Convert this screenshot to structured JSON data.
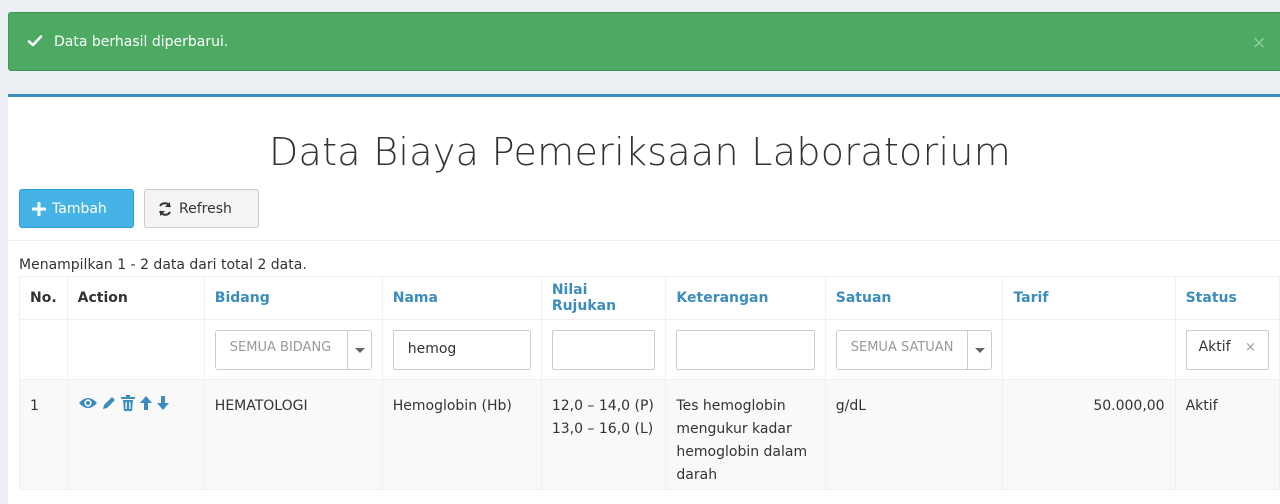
{
  "alert": {
    "message": "Data berhasil diperbarui.",
    "close": "×"
  },
  "page": {
    "title": "Data Biaya Pemeriksaan Laboratorium"
  },
  "toolbar": {
    "add_label": "Tambah",
    "refresh_label": "Refresh"
  },
  "summary": "Menampilkan 1 - 2 data dari total 2 data.",
  "columns": [
    "No.",
    "Action",
    "Bidang",
    "Nama",
    "Nilai Rujukan",
    "Keterangan",
    "Satuan",
    "Tarif",
    "Status"
  ],
  "filters": {
    "bidang": "SEMUA BIDANG",
    "nama": "hemog",
    "nilai_rujukan": "",
    "keterangan": "",
    "satuan": "SEMUA SATUAN",
    "status": "Aktif",
    "status_clear": "×"
  },
  "rows": [
    {
      "no": "1",
      "bidang": "HEMATOLOGI",
      "nama": "Hemoglobin (Hb)",
      "nilai_rujukan_1": "12,0 – 14,0 (P)",
      "nilai_rujukan_2": "13,0 – 16,0 (L)",
      "keterangan": "Tes hemoglobin mengukur kadar hemoglobin dalam darah",
      "satuan": "g/dL",
      "tarif": "50.000,00",
      "status": "Aktif"
    }
  ],
  "icons": [
    "check-icon",
    "plus-icon",
    "refresh-icon",
    "eye-icon",
    "pencil-icon",
    "trash-icon",
    "arrow-up-icon",
    "arrow-down-icon"
  ],
  "colors": {
    "success": "#4caa62",
    "primary": "#46b3e6",
    "link": "#3c8dbc",
    "box_accent": "#3c8dbc"
  }
}
